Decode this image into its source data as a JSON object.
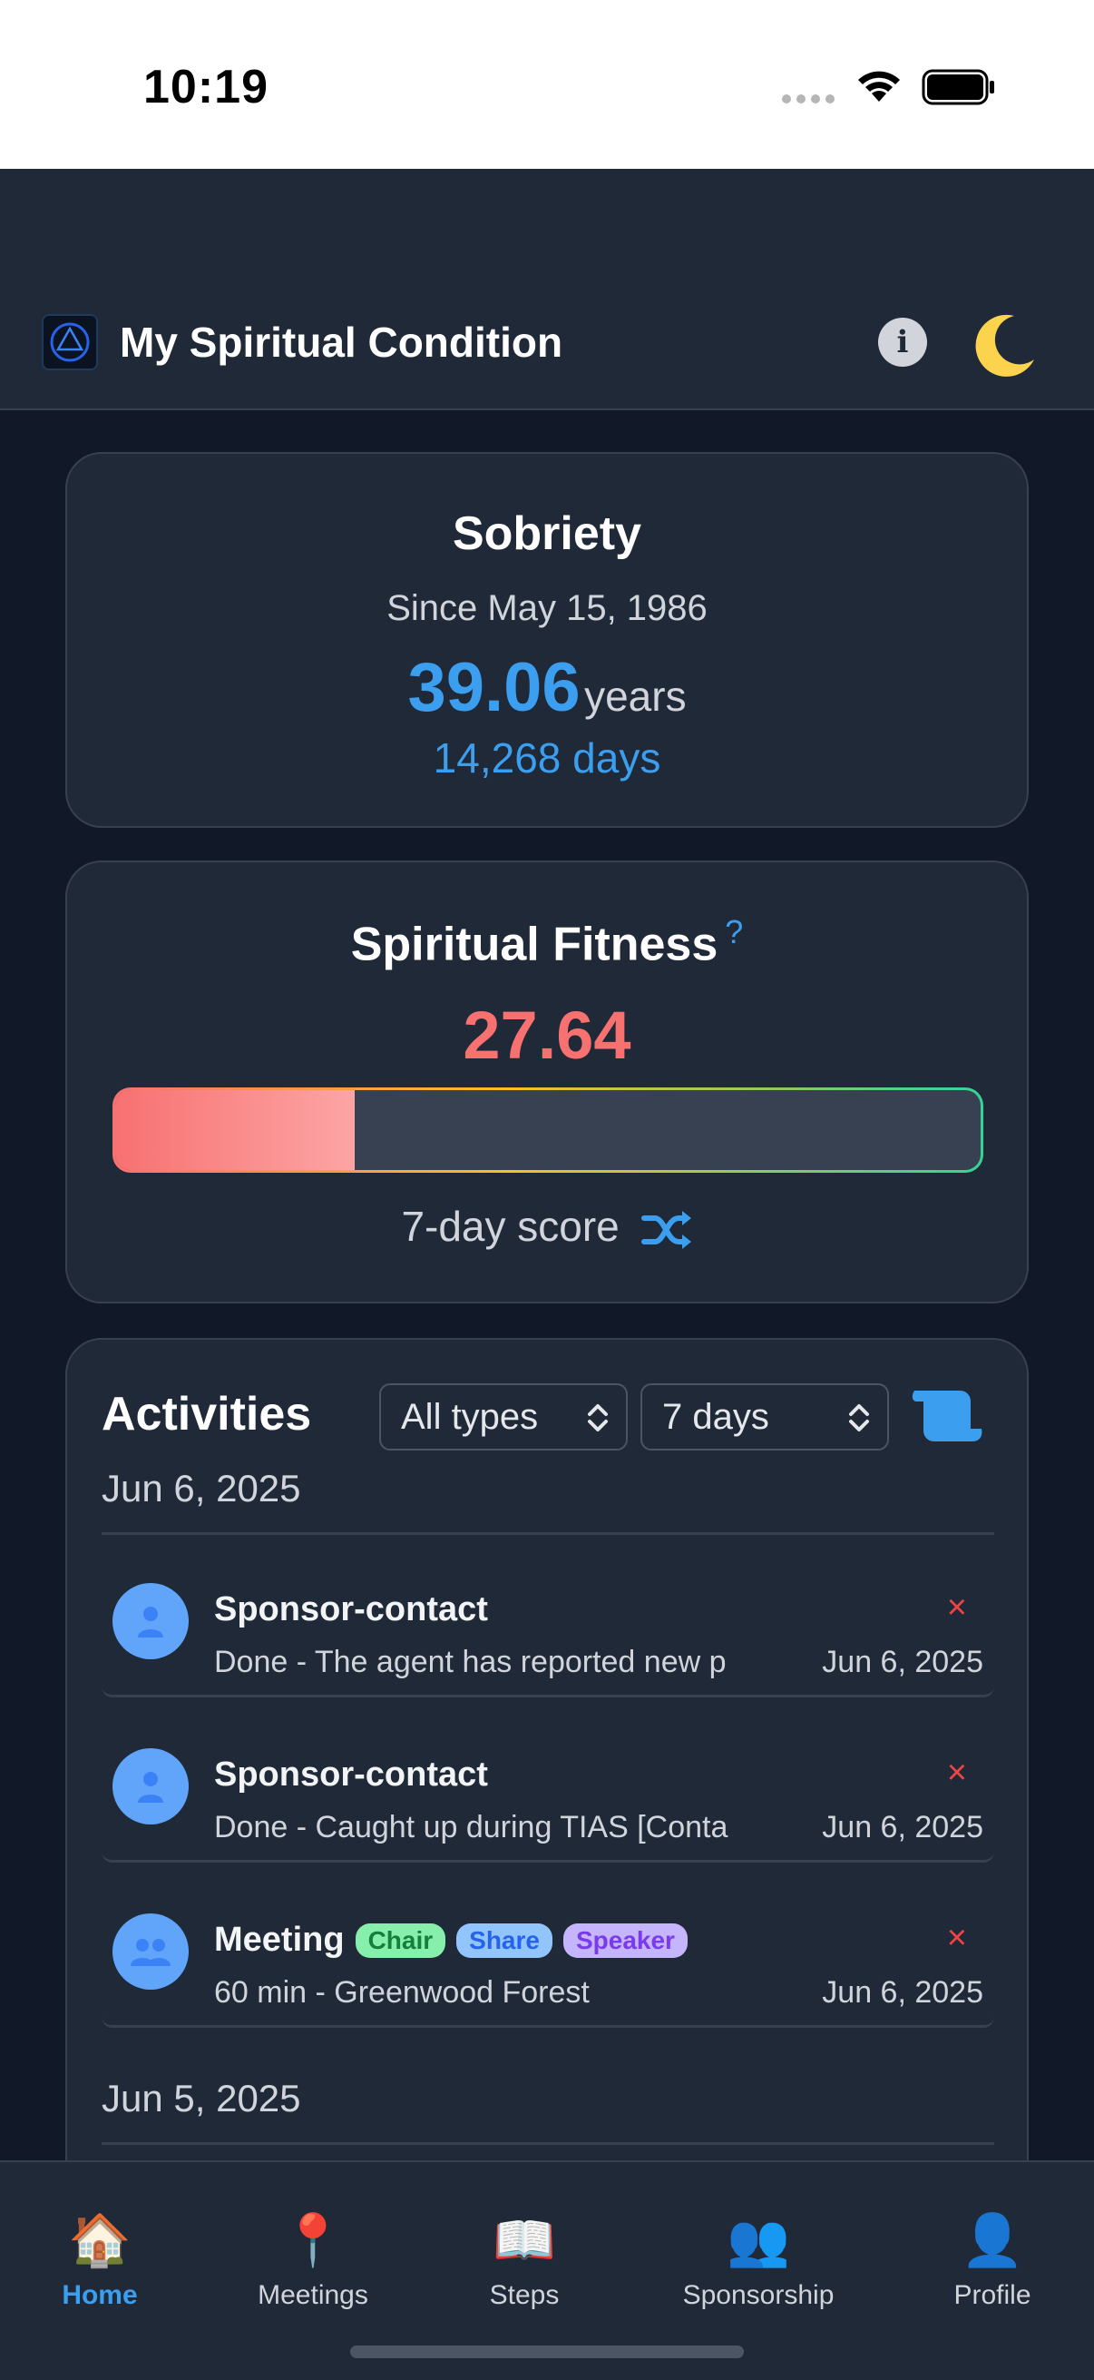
{
  "status_bar": {
    "time": "10:19"
  },
  "header": {
    "title": "My Spiritual Condition",
    "info_icon": "info-icon",
    "theme_icon": "moon-icon"
  },
  "sobriety": {
    "title": "Sobriety",
    "since": "Since May 15, 1986",
    "years": "39.06",
    "years_unit": "years",
    "days": "14,268 days"
  },
  "fitness": {
    "title": "Spiritual Fitness",
    "help": "?",
    "score": "27.64",
    "score_fraction": 0.2764,
    "caption": "7-day score",
    "colors": {
      "score": "#f87171",
      "accent": "#3b9eef"
    }
  },
  "activities": {
    "title": "Activities",
    "type_filter": "All types",
    "range_filter": "7 days",
    "groups": [
      {
        "date": "Jun 6, 2025",
        "items": [
          {
            "name": "Sponsor-contact",
            "detail": "Done - The agent has reported new p",
            "date": "Jun 6, 2025",
            "delete": "×"
          },
          {
            "name": "Sponsor-contact",
            "detail": "Done - Caught up during TIAS [Conta",
            "date": "Jun 6, 2025",
            "delete": "×"
          },
          {
            "name": "Meeting",
            "tags": [
              "Chair",
              "Share",
              "Speaker"
            ],
            "detail": "60 min - Greenwood Forest",
            "date": "Jun 6, 2025",
            "delete": "×"
          }
        ]
      },
      {
        "date": "Jun 5, 2025",
        "items": []
      }
    ]
  },
  "nav": {
    "items": [
      {
        "label": "Home",
        "icon": "🏠",
        "active": true
      },
      {
        "label": "Meetings",
        "icon": "📍",
        "active": false
      },
      {
        "label": "Steps",
        "icon": "📖",
        "active": false
      },
      {
        "label": "Sponsorship",
        "icon": "👥",
        "active": false
      },
      {
        "label": "Profile",
        "icon": "👤",
        "active": false
      }
    ]
  }
}
